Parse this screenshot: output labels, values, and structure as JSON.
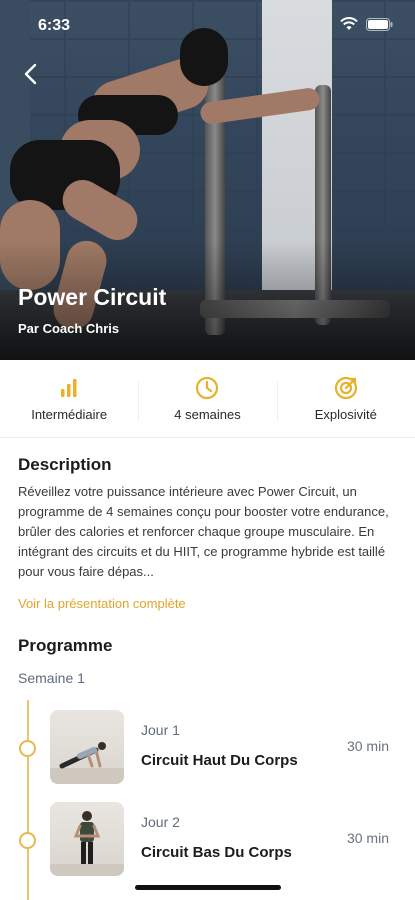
{
  "status": {
    "time": "6:33"
  },
  "hero": {
    "title": "Power Circuit",
    "subtitle": "Par Coach Chris"
  },
  "stats": [
    {
      "label": "Intermédiaire",
      "icon": "bar-chart-icon"
    },
    {
      "label": "4 semaines",
      "icon": "clock-icon"
    },
    {
      "label": "Explosivité",
      "icon": "target-icon"
    }
  ],
  "description": {
    "title": "Description",
    "text": "Réveillez votre puissance intérieure avec Power Circuit, un programme de 4 semaines conçu pour booster votre endurance, brûler des calories et renforcer chaque groupe musculaire. En intégrant des circuits et du HIIT, ce programme hybride est taillé pour vous faire dépas...",
    "link": "Voir la présentation complète"
  },
  "program": {
    "title": "Programme",
    "week": "Semaine 1",
    "sessions": [
      {
        "day": "Jour 1",
        "name": "Circuit Haut Du Corps",
        "duration": "30 min"
      },
      {
        "day": "Jour 2",
        "name": "Circuit Bas Du Corps",
        "duration": "30 min"
      }
    ]
  },
  "colors": {
    "accent": "#e0a52a",
    "muted": "#5f6b7d",
    "timeline": "#efc56b"
  }
}
